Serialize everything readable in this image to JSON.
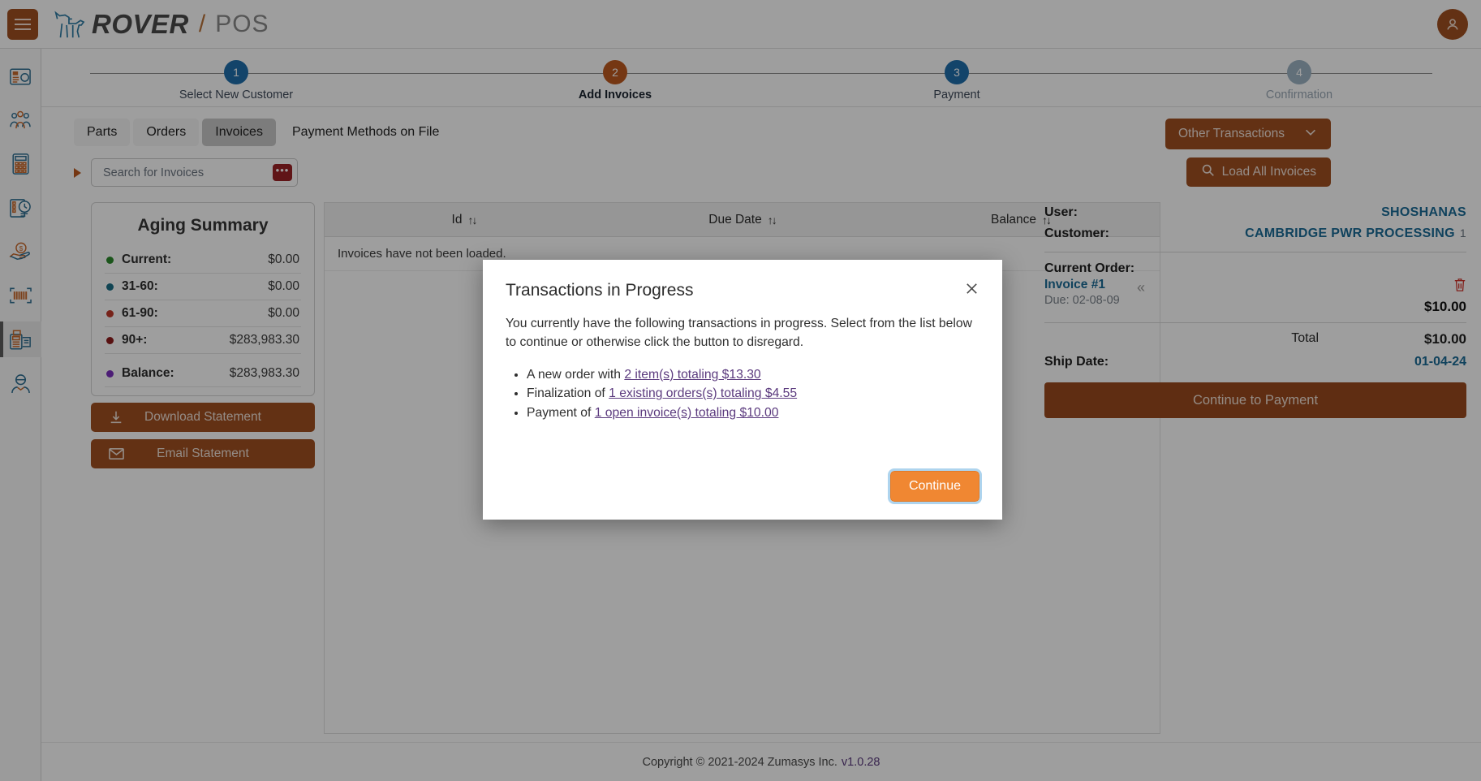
{
  "header": {
    "menu_icon": "hamburger-icon",
    "logo_icon": "dog-logo-icon",
    "brand": "ROVER",
    "slash": "/",
    "brand_sub": "POS",
    "avatar_icon": "user-avatar-icon"
  },
  "rail": {
    "items": [
      {
        "icon": "dashboard-icon",
        "active": false
      },
      {
        "icon": "customers-icon",
        "active": false
      },
      {
        "icon": "calculator-icon",
        "active": false
      },
      {
        "icon": "scheduling-icon",
        "active": false
      },
      {
        "icon": "payments-hand-icon",
        "active": false
      },
      {
        "icon": "barcode-icon",
        "active": false
      },
      {
        "icon": "pos-terminal-icon",
        "active": true
      },
      {
        "icon": "employee-icon",
        "active": false
      }
    ]
  },
  "stepper": {
    "steps": [
      {
        "number": "1",
        "label": "Select New Customer",
        "state": "done"
      },
      {
        "number": "2",
        "label": "Add Invoices",
        "state": "current"
      },
      {
        "number": "3",
        "label": "Payment",
        "state": "done"
      },
      {
        "number": "4",
        "label": "Confirmation",
        "state": "disabled"
      }
    ]
  },
  "tabs": [
    {
      "label": "Parts",
      "active": false
    },
    {
      "label": "Orders",
      "active": false
    },
    {
      "label": "Invoices",
      "active": true
    },
    {
      "label": "Payment Methods on File",
      "active": false
    }
  ],
  "search": {
    "placeholder": "Search for Invoices",
    "value": "",
    "dots_label": "•••",
    "expand_icon": "caret-right-icon"
  },
  "actions": {
    "other_transactions": "Other Transactions",
    "other_transactions_icon": "chevron-down-icon",
    "load_all_invoices": "Load All Invoices",
    "load_all_icon": "search-icon"
  },
  "aging": {
    "title": "Aging Summary",
    "rows": [
      {
        "label": "Current:",
        "value": "$0.00",
        "color": "#2d8a2d"
      },
      {
        "label": "31-60:",
        "value": "$0.00",
        "color": "#1a6e87"
      },
      {
        "label": "61-90:",
        "value": "$0.00",
        "color": "#c0392b"
      },
      {
        "label": "90+:",
        "value": "$283,983.30",
        "color": "#8e1c1c"
      },
      {
        "label": "Balance:",
        "value": "$283,983.30",
        "color": "#7b2fbe"
      }
    ],
    "download_statement": "Download Statement",
    "download_icon": "download-icon",
    "email_statement": "Email Statement",
    "email_icon": "envelope-icon"
  },
  "table": {
    "columns": [
      {
        "label": "Id",
        "sort_icon": "sort-updown-icon"
      },
      {
        "label": "Due Date",
        "sort_icon": "sort-updown-icon"
      },
      {
        "label": "Balance",
        "sort_icon": "sort-updown-icon"
      }
    ],
    "empty_message": "Invoices have not been loaded.",
    "pager_prev": "«"
  },
  "right_panel": {
    "user_label": "User:",
    "user_value": "SHOSHANAS",
    "customer_label": "Customer:",
    "customer_value": "CAMBRIDGE PWR PROCESSING",
    "customer_suffix": "1",
    "current_order_label": "Current Order:",
    "order": {
      "title": "Invoice #1",
      "due": "Due: 02-08-09",
      "amount": "$10.00",
      "delete_icon": "trash-icon"
    },
    "total_label": "Total",
    "total_value": "$10.00",
    "ship_date_label": "Ship Date:",
    "ship_date_value": "01-04-24",
    "continue_to_payment": "Continue to Payment"
  },
  "footer": {
    "text": "Copyright © 2021-2024 Zumasys Inc.",
    "version": "v1.0.28"
  },
  "modal": {
    "title": "Transactions in Progress",
    "close_icon": "close-icon",
    "paragraph": "You currently have the following transactions in progress. Select from the list below to continue or otherwise click the button to disregard.",
    "items": [
      {
        "prefix": "A new order with ",
        "link": "2 item(s) totaling $13.30"
      },
      {
        "prefix": "Finalization of ",
        "link": "1 existing orders(s) totaling $4.55"
      },
      {
        "prefix": "Payment of ",
        "link": "1 open invoice(s) totaling $10.00"
      }
    ],
    "continue_label": "Continue"
  },
  "colors": {
    "brand_brown": "#a04f21",
    "accent_blue": "#1a6b96",
    "continue_orange": "#f08732",
    "link_purple": "#5b3a7e"
  }
}
